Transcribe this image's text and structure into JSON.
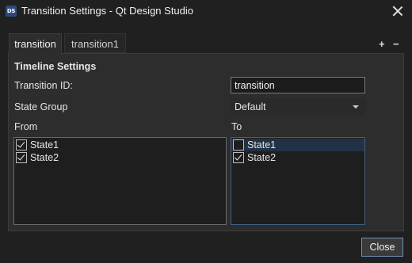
{
  "window": {
    "icon_text": "DS",
    "title": "Transition Settings - Qt Design Studio"
  },
  "tabs": [
    {
      "label": "transition",
      "active": true
    },
    {
      "label": "transition1",
      "active": false
    }
  ],
  "tab_actions": {
    "add": "+",
    "remove": "−"
  },
  "timeline": {
    "section_title": "Timeline Settings",
    "id_label": "Transition ID:",
    "id_value": "transition",
    "state_group_label": "State Group",
    "state_group_value": "Default"
  },
  "from": {
    "label": "From",
    "items": [
      {
        "label": "State1",
        "checked": true
      },
      {
        "label": "State2",
        "checked": true
      }
    ]
  },
  "to": {
    "label": "To",
    "items": [
      {
        "label": "State1",
        "checked": false
      },
      {
        "label": "State2",
        "checked": true
      }
    ]
  },
  "footer": {
    "close_label": "Close"
  },
  "colors": {
    "accent": "#6f8fb8",
    "background": "#202020",
    "panel": "#2d2d2d"
  }
}
